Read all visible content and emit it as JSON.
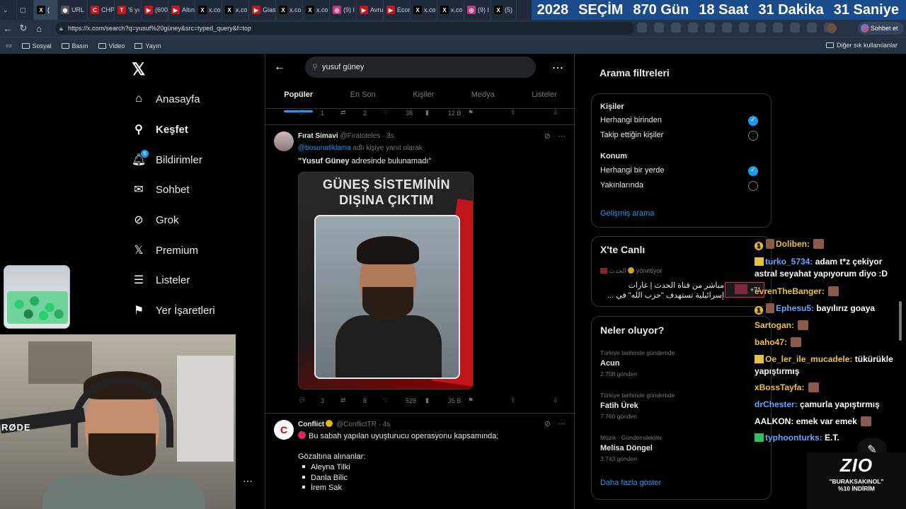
{
  "browser": {
    "tabs": [
      {
        "label": "(",
        "icon": "x-icon",
        "active": true
      },
      {
        "label": "URL",
        "icon": "globe-icon"
      },
      {
        "label": "CHP",
        "icon": "news-icon"
      },
      {
        "label": "'6 yı",
        "icon": "news-icon"
      },
      {
        "label": "(600",
        "icon": "youtube-icon"
      },
      {
        "label": "Altın",
        "icon": "youtube-icon"
      },
      {
        "label": "x.co",
        "icon": "x-icon"
      },
      {
        "label": "x.co",
        "icon": "x-icon"
      },
      {
        "label": "Glas",
        "icon": "youtube-icon"
      },
      {
        "label": "x.co",
        "icon": "x-icon"
      },
      {
        "label": "x.co",
        "icon": "x-icon"
      },
      {
        "label": "(9) I",
        "icon": "instagram-icon"
      },
      {
        "label": "Avru",
        "icon": "youtube-icon"
      },
      {
        "label": "Econ",
        "icon": "youtube-icon"
      },
      {
        "label": "x.co",
        "icon": "x-icon"
      },
      {
        "label": "x.co",
        "icon": "x-icon"
      },
      {
        "label": "(9) I",
        "icon": "instagram-icon"
      },
      {
        "label": "(5)",
        "icon": "x-icon"
      }
    ],
    "countdown": {
      "year": "2028",
      "word": "SEÇİM",
      "days": "870 Gün",
      "hours": "18 Saat",
      "minutes": "31 Dakika",
      "seconds": "31 Saniye"
    },
    "url": "https://x.com/search?q=yusuf%20güney&src=typed_query&f=top",
    "chat_button": "Sohbet et",
    "bookmarks": [
      "Sosyal",
      "Basın",
      "Video",
      "Yayın"
    ],
    "other_bookmarks": "Diğer sık kullanılanlar"
  },
  "nav": {
    "items": [
      {
        "label": "Anasayfa",
        "icon": "home-icon"
      },
      {
        "label": "Keşfet",
        "icon": "search-icon"
      },
      {
        "label": "Bildirimler",
        "icon": "bell-icon"
      },
      {
        "label": "Sohbet",
        "icon": "mail-icon"
      },
      {
        "label": "Grok",
        "icon": "grok-icon"
      },
      {
        "label": "Premium",
        "icon": "x-premium-icon"
      },
      {
        "label": "Listeler",
        "icon": "list-icon"
      },
      {
        "label": "Yer İşaretleri",
        "icon": "bookmark-icon"
      }
    ],
    "notification_badge": "6"
  },
  "search": {
    "query": "yusuf güney",
    "tabs": [
      "Popüler",
      "En Son",
      "Kişiler",
      "Medya",
      "Listeler"
    ],
    "active_tab": "Popüler"
  },
  "tweets": [
    {
      "top_actions": {
        "replies": "1",
        "retweets": "2",
        "likes": "38",
        "views": "12 B"
      }
    },
    {
      "name": "Fırat Simavi",
      "handle": "@Firatoteles",
      "time": "3s",
      "reply_to": "@bosunatiklama",
      "reply_suffix": "adlı kişiye yanıt olarak",
      "text_bold": "\"Yusuf Güney",
      "text_rest": " adresinde bulunamadı\"",
      "media_title_1": "GÜNEŞ SİSTEMİNİN",
      "media_title_2": "DIŞINA ÇIKTIM",
      "actions": {
        "replies": "3",
        "retweets": "8",
        "likes": "528",
        "views": "35 B"
      }
    },
    {
      "name": "Conflict",
      "handle": "@ConflictTR",
      "time": "4s",
      "line1": "Bu sabah yapılan uyuşturucu operasyonu kapsamında;",
      "line2": "Gözaltına alınanlar:",
      "detained": [
        "Aleyna Tilki",
        "Danla Bilic",
        "İrem Sak"
      ]
    }
  ],
  "filters": {
    "title": "Arama filtreleri",
    "people_heading": "Kişiler",
    "people_options": [
      "Herhangi birinden",
      "Takip ettiğin kişiler"
    ],
    "location_heading": "Konum",
    "location_options": [
      "Herhangi bir yerde",
      "Yakınlarında"
    ],
    "advanced": "Gelişmiş arama"
  },
  "live": {
    "title": "X'te Canlı",
    "host": "الحدث",
    "host_status": "yönetiyor",
    "text_1": "مباشر من قناة الحدث | غارات",
    "text_2": "إسرائيلية تستهدف \"حزب الله\" في ...",
    "listeners": "+71"
  },
  "trends": {
    "title": "Neler oluyor?",
    "items": [
      {
        "meta": "Türkiye tarihinde gündemde",
        "name": "Acun",
        "posts": "2.708 gönderi"
      },
      {
        "meta": "Türkiye tarihinde gündemde",
        "name": "Fatih Ürek",
        "posts": "7.760 gönderi"
      },
      {
        "meta": "Müzik · Gündemdekiler",
        "name": "Melisa Döngel",
        "posts": "3.743 gönderi"
      }
    ],
    "more": "Daha fazla göster"
  },
  "chat_overlay": [
    {
      "user": "Doliben:",
      "msg": "",
      "badge": "1"
    },
    {
      "user": "turko_5734:",
      "msg": "adam t*z çekiyor astral seyahat yapıyorum diyo :D"
    },
    {
      "user": "evrenTheBanger:",
      "msg": ""
    },
    {
      "user": "Ephesu5:",
      "msg": "bayılırız goaya",
      "badge": "1"
    },
    {
      "user": "Sartogan:",
      "msg": ""
    },
    {
      "user": "baho47:",
      "msg": ""
    },
    {
      "user": "Oe_ler_ile_mucadele:",
      "msg": "tükürükle yapıştırmış"
    },
    {
      "user": "xBossTayfa:",
      "msg": ""
    },
    {
      "user": "drChester:",
      "msg": "çamurla yapıştırmış"
    },
    {
      "user": "AALKON:",
      "msg": "emek var emek"
    },
    {
      "user": "typhoonturks:",
      "msg": "E.T."
    }
  ],
  "stream": {
    "mic_brand": "RØDE",
    "promo_logo": "ZIO",
    "promo_code": "\"BURAKSAKINOL\"",
    "promo_discount": "%10 İNDİRİM"
  }
}
